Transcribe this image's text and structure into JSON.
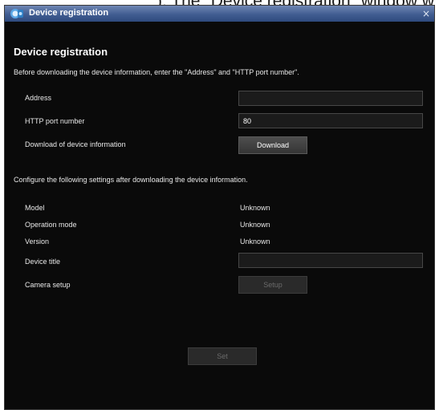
{
  "caption": {
    "text": "), The \"Device registration\" window w"
  },
  "window": {
    "title": "Device registration",
    "close_glyph": "×",
    "icons": {
      "app": "camera-app-icon",
      "close": "close-icon"
    }
  },
  "section": {
    "heading": "Device registration",
    "intro": "Before downloading the device information, enter the \"Address\" and \"HTTP port number\"."
  },
  "download_form": {
    "address_label": "Address",
    "address_value": "",
    "port_label": "HTTP port number",
    "port_value": "80",
    "download_label": "Download of device information",
    "download_button": "Download"
  },
  "settings": {
    "instruction": "Configure the following settings after downloading the device information.",
    "model_label": "Model",
    "model_value": "Unknown",
    "operation_mode_label": "Operation mode",
    "operation_mode_value": "Unknown",
    "version_label": "Version",
    "version_value": "Unknown",
    "device_title_label": "Device title",
    "device_title_value": "",
    "camera_setup_label": "Camera setup",
    "setup_button": "Setup"
  },
  "footer": {
    "set_button": "Set"
  },
  "colors": {
    "window_bg": "#0a0a0a",
    "titlebar": "#415d91",
    "text": "#e8e8e8",
    "field_bg": "#1b1b1b"
  }
}
